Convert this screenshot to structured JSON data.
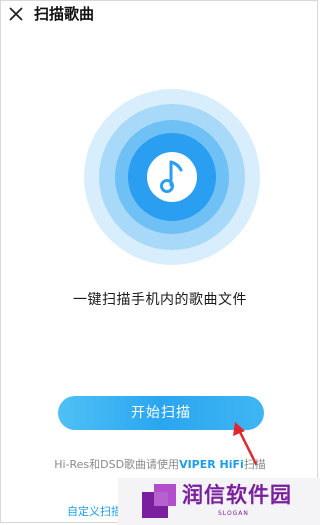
{
  "header": {
    "title": "扫描歌曲",
    "close_icon": "close-icon"
  },
  "scan": {
    "icon": "music-note-icon",
    "description": "一键扫描手机内的歌曲文件",
    "start_button_label": "开始扫描"
  },
  "note": {
    "prefix": "Hi-Res和DSD歌曲请使用",
    "link_text": "VIPER HiFi",
    "suffix": "扫描"
  },
  "custom_scan_label": "自定义扫描",
  "watermark": {
    "text": "润信软件园",
    "slogan": "SLOGAN"
  },
  "colors": {
    "accent": "#2aa6ef",
    "ring_outer": "#d8eefc",
    "ring_middle": "#a9d9f8",
    "ring_inner": "#6fc0f4",
    "core": "#2a9ef0",
    "annotation_arrow": "#e0252b",
    "watermark": "#7a1f9e"
  }
}
